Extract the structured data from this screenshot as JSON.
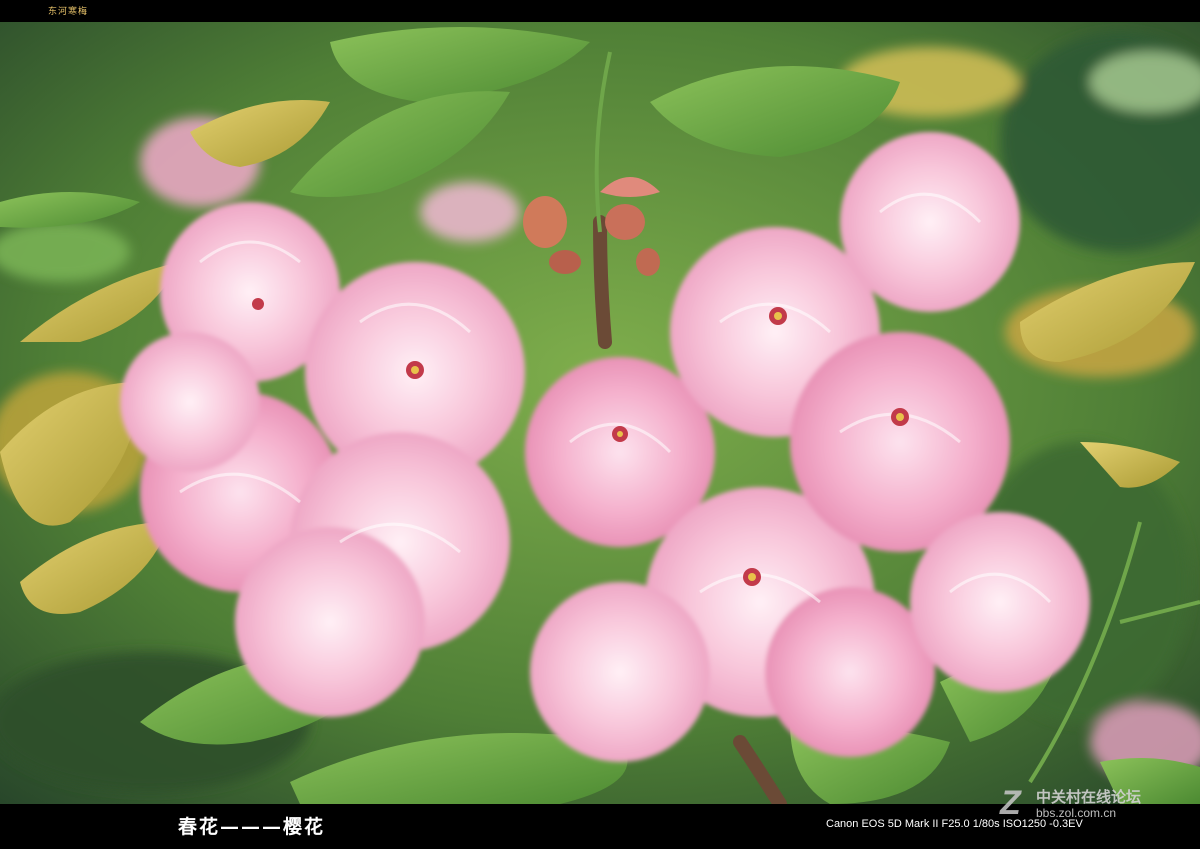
{
  "top_caption": "东河寒梅",
  "title": "春花———樱花",
  "camera_info": "Canon EOS 5D Mark II F25.0 1/80s ISO1250 -0.3EV",
  "watermark": {
    "mark": "Z",
    "name": "中关村在线论坛",
    "url": "bbs.zol.com.cn"
  },
  "colors": {
    "frame": "#000000",
    "blossom": "#f6bdd4",
    "leaf": "#5f9a3c",
    "leaf_yellow": "#c9b44a"
  }
}
